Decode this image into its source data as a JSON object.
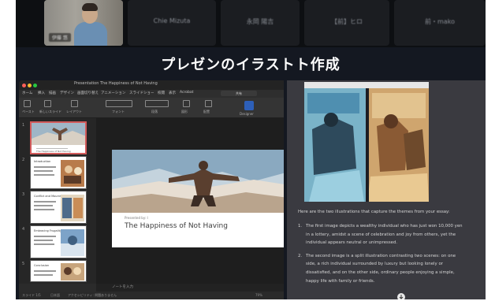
{
  "participants": [
    {
      "name": "伊藤 悠",
      "self": true
    },
    {
      "name": "Chie Mizuta"
    },
    {
      "name": "永岡 陽吉"
    },
    {
      "name": "【前】ヒロ"
    },
    {
      "name": "前・mako"
    }
  ],
  "share": {
    "heading": "プレゼンのイラストト作成"
  },
  "powerpoint": {
    "window_title": "Presentation The Happiness of Not Having",
    "tabs": [
      "ホーム",
      "挿入",
      "描画",
      "デザイン",
      "画面切り替え",
      "アニメーション",
      "スライドショー",
      "校閲",
      "表示",
      "Acrobat"
    ],
    "share_button": "共有",
    "ribbon_labels": [
      "ペースト",
      "新しいスライド",
      "レイアウト",
      "フォント",
      "段落",
      "図形",
      "配置",
      "デザイナー"
    ],
    "designer_label": "Designer",
    "slide": {
      "subtitle": "Presented by: I",
      "title": "The Happiness of Not Having"
    },
    "thumbnails": [
      {
        "num": "1",
        "text": "The Happiness of Not Having"
      },
      {
        "num": "2",
        "text": "Introduction"
      },
      {
        "num": "3",
        "text": "Conflict and Mourns"
      },
      {
        "num": "4",
        "text": "Embracing Frugality"
      },
      {
        "num": "5",
        "text": "Conclusion"
      }
    ],
    "notes_placeholder": "ノートを入力",
    "status": {
      "slide_count": "スライド 1/5",
      "language": "日本語",
      "accessibility": "アクセシビリティ: 問題ありません",
      "zoom": "79%"
    }
  },
  "chat": {
    "intro": "Here are the two illustrations that capture the themes from your essay:",
    "items": [
      {
        "num": "1.",
        "lines": [
          "The first image depicts a wealthy individual who has just won 10,000 yen",
          "in a lottery, amidst a scene of celebration and joy from others, yet the",
          "individual appears neutral or unimpressed."
        ]
      },
      {
        "num": "2.",
        "lines": [
          "The second image is a split illustration contrasting two scenes: on one",
          "side, a rich individual surrounded by luxury but looking lonely or",
          "dissatisfied, and on the other side, ordinary people enjoying a simple,",
          "happy life with family or friends."
        ]
      }
    ]
  }
}
